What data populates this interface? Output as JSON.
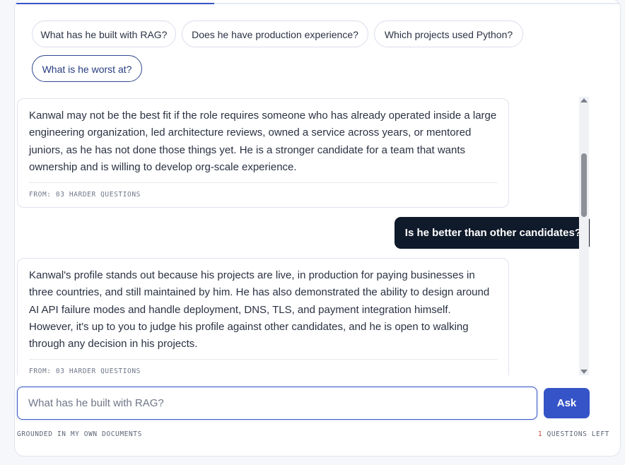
{
  "progress": {
    "fraction": 0.33,
    "color": "#3554c7"
  },
  "suggestions": [
    {
      "label": "What has he built with RAG?"
    },
    {
      "label": "Does he have production experience?"
    },
    {
      "label": "Which projects used Python?"
    },
    {
      "label": "What is he worst at?"
    }
  ],
  "messages": {
    "answer1": {
      "text": "Kanwal may not be the best fit if the role requires someone who has already operated inside a large engineering organization, led architecture reviews, owned a service across years, or mentored juniors, as he has not done those things yet. He is a stronger candidate for a team that wants ownership and is willing to develop org-scale experience.",
      "source": "FROM: 03 HARDER QUESTIONS"
    },
    "user1": {
      "text": "Is he better than other candidates?"
    },
    "answer2": {
      "text": "Kanwal's profile stands out because his projects are live, in production for paying businesses in three countries, and still maintained by him. He has also demonstrated the ability to design around AI API failure modes and handle deployment, DNS, TLS, and payment integration himself. However, it's up to you to judge his profile against other candidates, and he is open to walking through any decision in his projects.",
      "source": "FROM: 03 HARDER QUESTIONS"
    }
  },
  "input": {
    "placeholder": "What has he built with RAG?",
    "value": ""
  },
  "ask_button": {
    "label": "Ask"
  },
  "footer": {
    "grounded_label": "GROUNDED IN MY OWN DOCUMENTS",
    "questions_left_count": "1",
    "questions_left_label": " QUESTIONS LEFT"
  },
  "colors": {
    "accent": "#3554c7",
    "user_bubble": "#0f1a2b",
    "count": "#c8473a"
  }
}
